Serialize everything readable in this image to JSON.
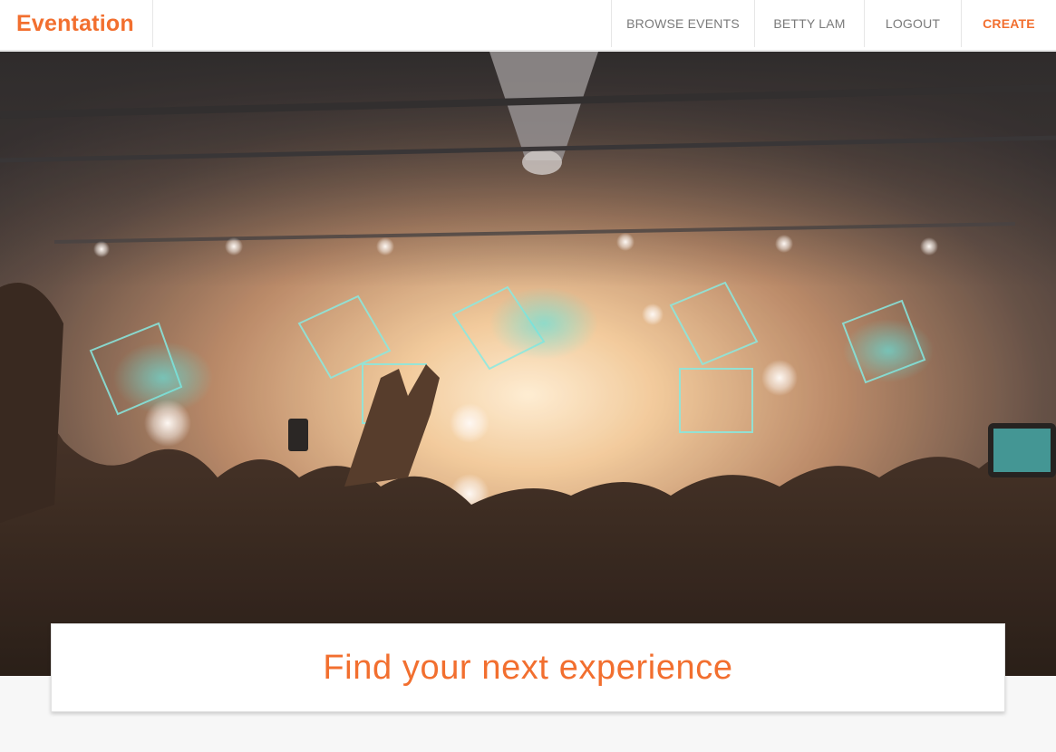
{
  "brand": {
    "name": "Eventation",
    "accent": "#f26f2f"
  },
  "nav": {
    "browse_label": "BROWSE EVENTS",
    "user_label": "BETTY LAM",
    "logout_label": "LOGOUT",
    "create_label": "CREATE"
  },
  "hero": {
    "image_subject": "concert-crowd-photo"
  },
  "search": {
    "heading": "Find your next experience"
  }
}
